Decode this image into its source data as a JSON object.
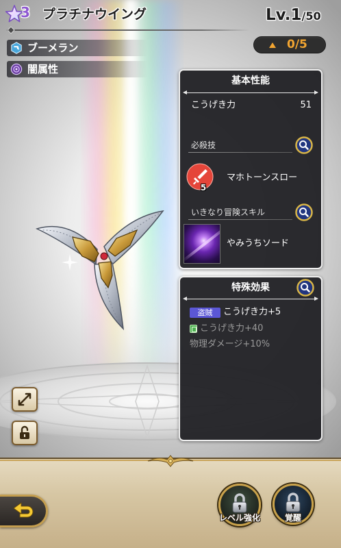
{
  "header": {
    "rarity": "3",
    "weapon_name": "プラチナウイング",
    "level": "Lv.1",
    "level_max": "/50",
    "limit_break": "0/5"
  },
  "tags": [
    {
      "icon": "boomerang-type-icon",
      "label": "ブーメラン"
    },
    {
      "icon": "dark-element-icon",
      "label": "闇属性"
    }
  ],
  "basic_panel": {
    "title": "基本性能",
    "attack_label": "こうげき力",
    "attack_value": "51",
    "special_skill_heading": "必殺技",
    "special_skill_name": "マホトーンスロー",
    "special_skill_uses": "5",
    "adventure_skill_heading": "いきなり冒険スキル",
    "adventure_skill_name": "やみうちソード"
  },
  "effects_panel": {
    "title": "特殊効果",
    "effects": [
      {
        "badge": "盗賊",
        "text": "こうげき力+5",
        "active": true
      },
      {
        "text": "こうげき力+40",
        "active": false
      },
      {
        "text": "物理ダメージ+10%",
        "active": false
      }
    ]
  },
  "footer": {
    "level_up_label": "レベル強化",
    "awaken_label": "覚醒"
  },
  "colors": {
    "accent_orange": "#f2a531",
    "panel_bg": "#26262a",
    "thief_badge": "#5b57d6",
    "limit_break_icon": "#4caf50",
    "skill_red": "#e5453a",
    "inactive_text": "#9a9a9a",
    "frame_gold": "#c9a24b"
  }
}
